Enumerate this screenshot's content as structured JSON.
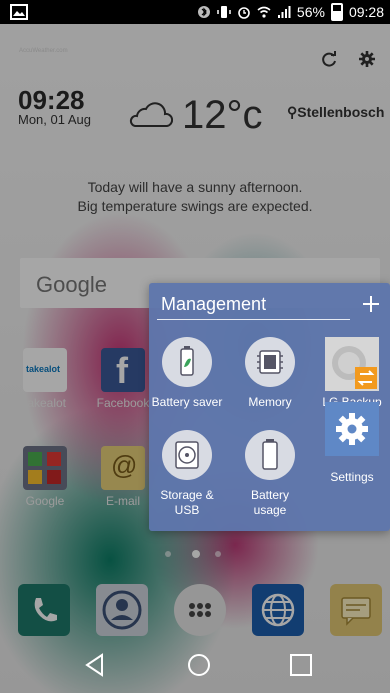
{
  "status_bar": {
    "battery_percent": "56%",
    "time": "09:28"
  },
  "weather": {
    "provider": "AccuWeather.com",
    "time": "09:28",
    "date": "Mon, 01 Aug",
    "temperature": "12°c",
    "location": "Stellenbosch",
    "forecast_line1": "Today will have a sunny afternoon.",
    "forecast_line2": "Big temperature swings are expected."
  },
  "search": {
    "label": "Google"
  },
  "apps": [
    {
      "label": "takealot",
      "icon": "takealot-app-icon"
    },
    {
      "label": "Facebook",
      "icon": "facebook-app-icon"
    },
    {
      "label": "Google",
      "icon": "google-folder-icon"
    },
    {
      "label": "E-mail",
      "icon": "email-app-icon"
    }
  ],
  "management": {
    "title": "Management",
    "items": [
      {
        "label": "Battery saver",
        "icon": "battery-saver-icon"
      },
      {
        "label": "Memory",
        "icon": "memory-icon"
      },
      {
        "label": "LG Backup",
        "icon": "lg-backup-icon"
      },
      {
        "label": "Storage &",
        "label2": "USB",
        "icon": "storage-icon"
      },
      {
        "label": "Battery",
        "label2": "usage",
        "icon": "battery-usage-icon"
      },
      {
        "label": "Settings",
        "icon": "settings-gear-icon"
      }
    ]
  },
  "dock": [
    {
      "icon": "phone-icon"
    },
    {
      "icon": "contacts-icon"
    },
    {
      "icon": "apps-drawer-icon"
    },
    {
      "icon": "browser-globe-icon"
    },
    {
      "icon": "messages-icon"
    }
  ],
  "colors": {
    "panel": "#5e76ac",
    "settings_tile": "#5f88c6",
    "backup_badge": "#f29a1f"
  }
}
